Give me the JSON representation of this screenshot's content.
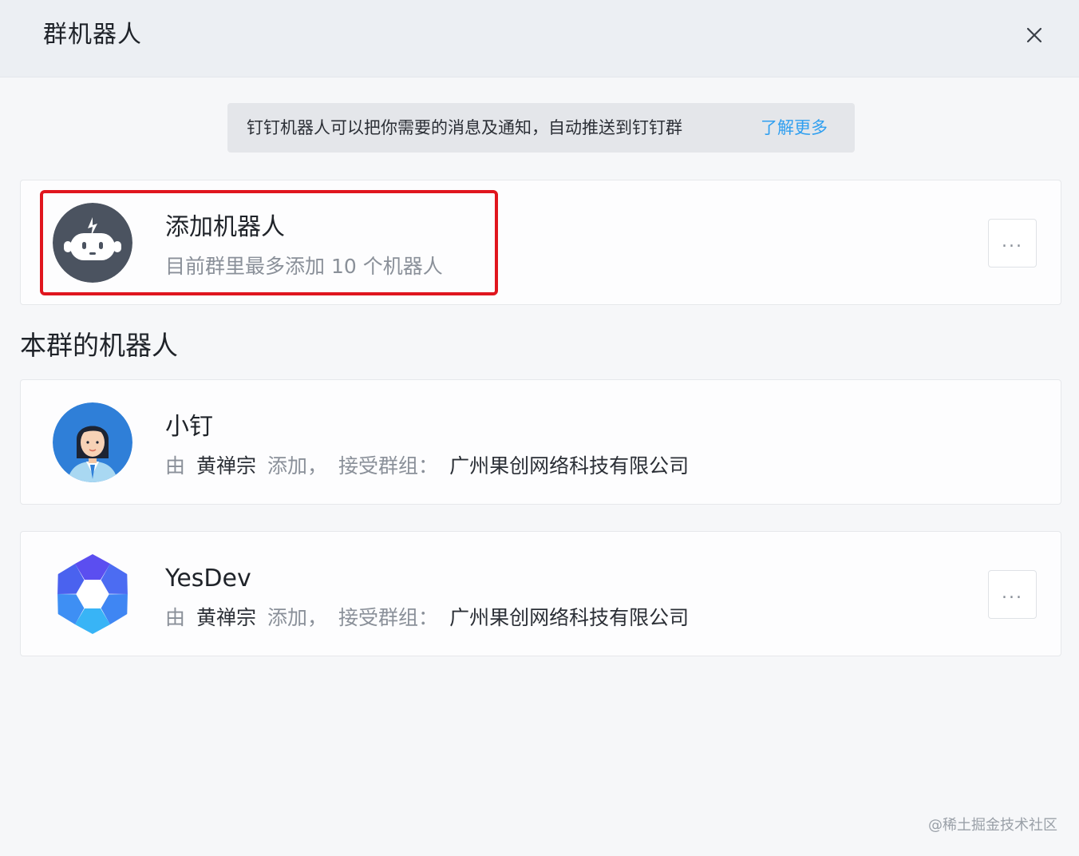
{
  "dialog": {
    "title": "群机器人",
    "close_icon": "close-icon"
  },
  "notice": {
    "text": "钉钉机器人可以把你需要的消息及通知，自动推送到钉钉群",
    "link": "了解更多"
  },
  "add_robot": {
    "title": "添加机器人",
    "subtitle": "目前群里最多添加 10 个机器人",
    "icon": "robot-icon",
    "more_label": "..."
  },
  "section": {
    "title": "本群的机器人"
  },
  "robots": [
    {
      "name": "小钉",
      "by": "由",
      "creator": "黄禅宗",
      "added": "添加，",
      "receive_label": "接受群组：",
      "group": "广州果创网络科技有限公司",
      "avatar": "woman-avatar-icon"
    },
    {
      "name": "YesDev",
      "by": "由",
      "creator": "黄禅宗",
      "added": "添加，",
      "receive_label": "接受群组：",
      "group": "广州果创网络科技有限公司",
      "avatar": "yesdev-logo-icon",
      "more_label": "..."
    }
  ],
  "watermark": "@稀土掘金技术社区",
  "colors": {
    "link": "#2f9ff0",
    "highlight": "#e0161e",
    "robot_avatar_bg": "#4b5360"
  }
}
